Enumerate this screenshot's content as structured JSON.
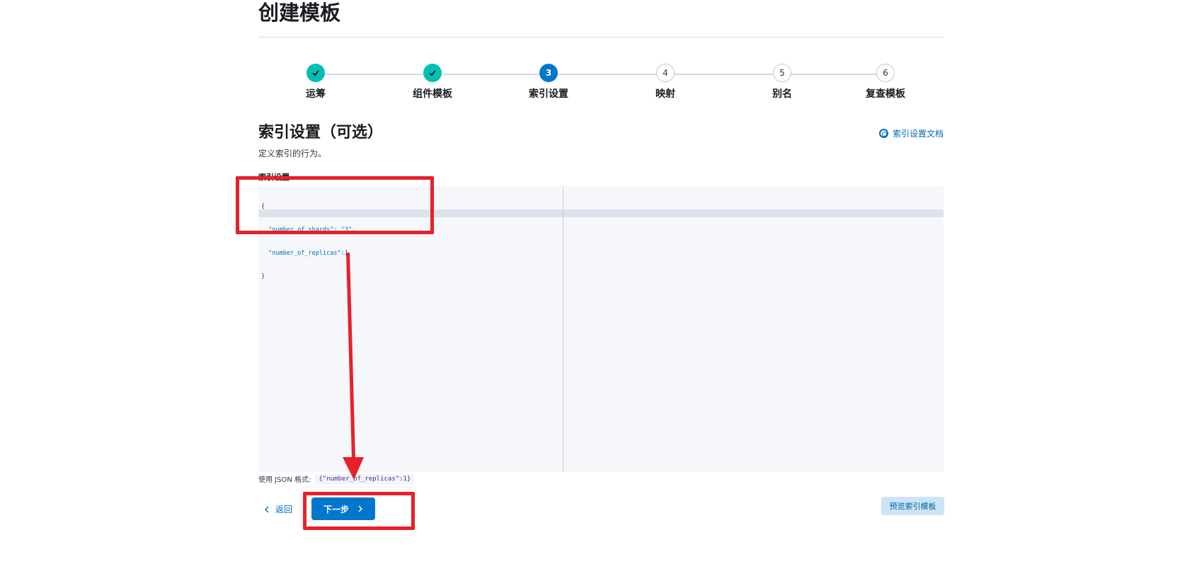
{
  "page": {
    "title": "创建模板"
  },
  "steps": [
    {
      "number": "1",
      "label": "运筹",
      "status": "complete"
    },
    {
      "number": "2",
      "label": "组件模板",
      "status": "complete"
    },
    {
      "number": "3",
      "label": "索引设置",
      "status": "current"
    },
    {
      "number": "4",
      "label": "映射",
      "status": "incomplete"
    },
    {
      "number": "5",
      "label": "别名",
      "status": "incomplete"
    },
    {
      "number": "6",
      "label": "复查模板",
      "status": "incomplete"
    }
  ],
  "section": {
    "title": "索引设置（可选）",
    "description": "定义索引的行为。",
    "docs_link": "索引设置文档"
  },
  "editor": {
    "label": "索引设置",
    "lines": [
      "{",
      "  \"number_of_shards\": \"3\",",
      "  \"number_of_replicas\":1",
      "}"
    ]
  },
  "json_hint": {
    "label": "使用 JSON 格式:",
    "example": "{\"number_of_replicas\":1}"
  },
  "footer": {
    "back_label": "返回",
    "next_label": "下一步",
    "preview_label": "预览索引模板"
  },
  "colors": {
    "accent": "#0077cc",
    "complete": "#00bfb3",
    "annotation": "#e8202a"
  },
  "icons": {
    "check": "check-icon",
    "docs": "help-icon",
    "back": "chevron-left-icon",
    "next": "chevron-right-icon"
  }
}
